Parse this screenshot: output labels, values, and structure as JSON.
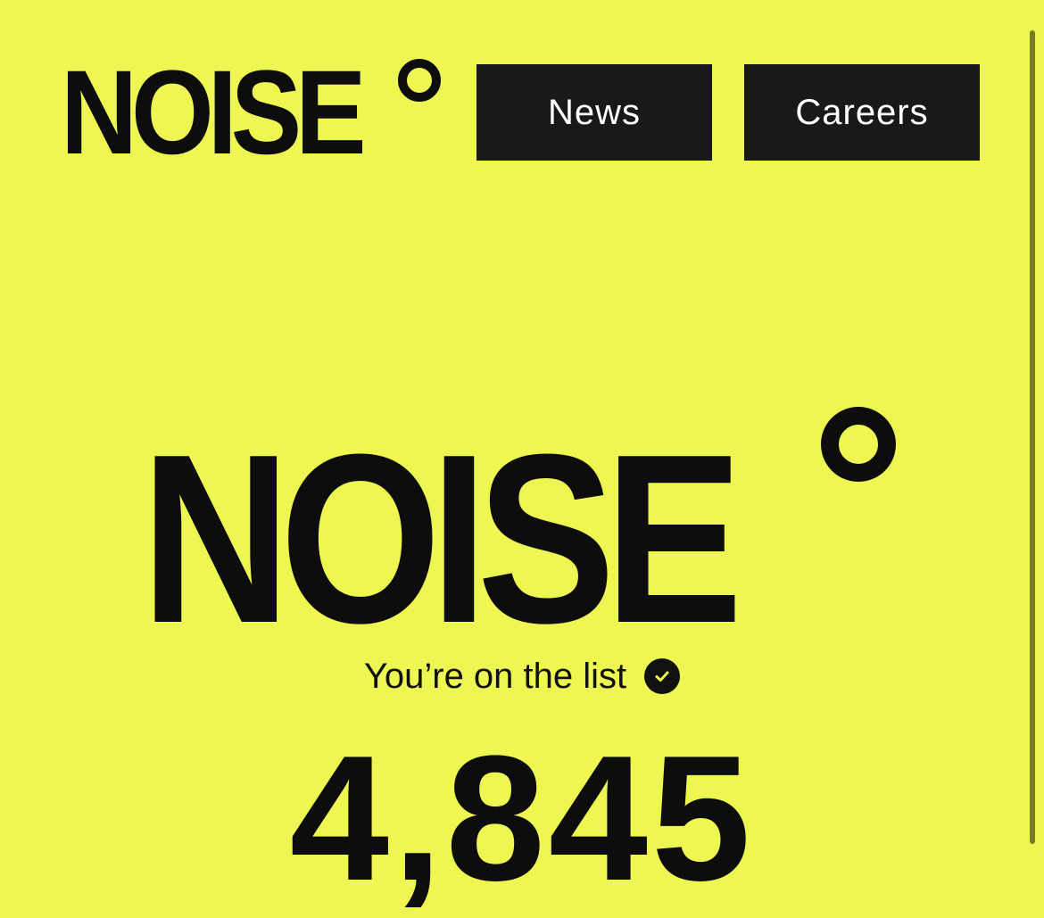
{
  "header": {
    "logo_text": "NOISE",
    "nav": {
      "news_label": "News",
      "careers_label": "Careers"
    }
  },
  "hero": {
    "logo_text": "NOISE",
    "status_text": "You’re on the list",
    "status_icon": "check-circle-icon",
    "count": "4,845"
  },
  "colors": {
    "background": "#eef752",
    "text": "#0d0d0d",
    "button_bg": "#191919",
    "button_text": "#ffffff"
  }
}
